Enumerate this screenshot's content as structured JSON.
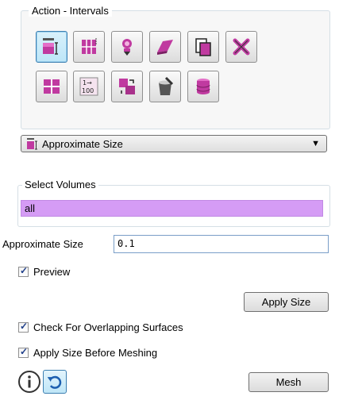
{
  "actions": {
    "title": "Action - Intervals",
    "tools": [
      {
        "name": "approximate-size-icon",
        "active": true
      },
      {
        "name": "grid-interval-icon",
        "active": false
      },
      {
        "name": "auto-factor-icon",
        "active": false
      },
      {
        "name": "smooth-eraser-icon",
        "active": false
      },
      {
        "name": "copy-document-icon",
        "active": false
      },
      {
        "name": "remove-icon",
        "active": false
      },
      {
        "name": "mesh-block-icon",
        "active": false
      },
      {
        "name": "interval-count-icon",
        "active": false
      },
      {
        "name": "match-intervals-icon",
        "active": false
      },
      {
        "name": "paint-bucket-icon",
        "active": false
      },
      {
        "name": "volume-cylinder-icon",
        "active": false
      }
    ]
  },
  "method": {
    "selected": "Approximate Size",
    "accent": "#cc3399"
  },
  "select_volumes": {
    "title": "Select Volumes",
    "value": "all",
    "highlight": "#d59cf5"
  },
  "approx_size": {
    "label": "Approximate Size",
    "value": "0.1"
  },
  "preview": {
    "label": "Preview",
    "checked": true
  },
  "apply_size_button": "Apply Size",
  "overlap": {
    "label": "Check For Overlapping Surfaces",
    "checked": true
  },
  "apply_before": {
    "label": "Apply Size Before Meshing",
    "checked": true
  },
  "mesh_button": "Mesh",
  "footer": {
    "info_icon": "info-icon",
    "undo_icon": "undo-icon"
  }
}
